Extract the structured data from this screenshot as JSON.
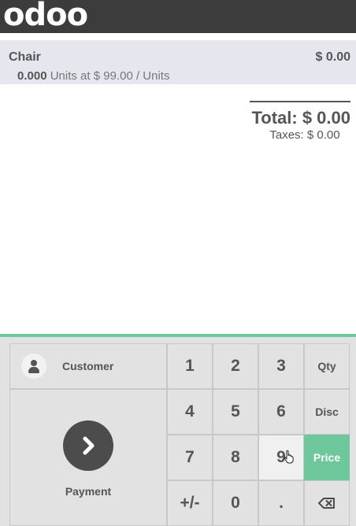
{
  "header": {
    "logo_text": "odoo"
  },
  "order": {
    "line": {
      "product_name": "Chair",
      "price": "$ 0.00",
      "quantity": "0.000",
      "unit_info": " Units at $ 99.00 / Units"
    },
    "summary": {
      "total": "Total: $ 0.00",
      "taxes": "Taxes: $ 0.00"
    }
  },
  "actions": {
    "customer_label": "Customer",
    "customer_icon": "user-icon",
    "payment_label": "Payment",
    "payment_icon": "chevron-right-icon"
  },
  "numpad": {
    "keys": [
      "1",
      "2",
      "3",
      "4",
      "5",
      "6",
      "7",
      "8",
      "9",
      "+/-",
      "0",
      "."
    ],
    "modes": [
      "Qty",
      "Disc",
      "Price"
    ],
    "active_mode": "Price",
    "backspace_icon": "backspace-icon"
  },
  "colors": {
    "accent": "#6ec89b",
    "topbar": "#3c3c3c",
    "orderline_bg": "#e6e7ee",
    "pad_bg": "#e2e2e2"
  }
}
